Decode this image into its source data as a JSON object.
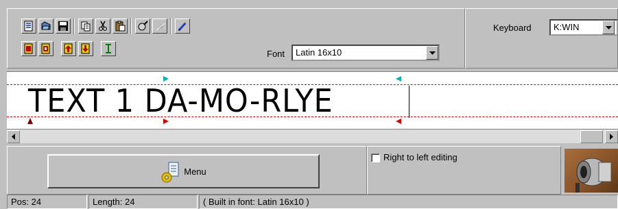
{
  "toolbar": {
    "row1_icons": [
      "new-document-icon",
      "open-folder-icon",
      "save-disk-icon",
      "copy-icon",
      "cut-scissors-icon",
      "paste-clipboard-icon",
      "edit-tool-icon",
      "disabled-tool-icon",
      "pen-icon"
    ],
    "row2_icons": [
      "page-red-icon",
      "page-red-2-icon",
      "insert-up-icon",
      "insert-down-icon",
      "text-cursor-icon"
    ]
  },
  "font": {
    "label": "Font",
    "value": "Latin 16x10"
  },
  "keyboard": {
    "label": "Keyboard",
    "value": "K:WIN"
  },
  "editor": {
    "text": "TEXT 1 DA-MO-RLYE"
  },
  "menu_button": {
    "label": "Menu"
  },
  "rtl": {
    "label": "Right to left editing",
    "checked": false
  },
  "status": {
    "pos": "Pos: 24",
    "length": "Length: 24",
    "font_info": "( Built in font: Latin 16x10 )"
  },
  "colors": {
    "background": "#c0c0c0",
    "guide": "#e00000",
    "marker_cyan": "#00b0c0",
    "marker_red": "#e00000"
  }
}
